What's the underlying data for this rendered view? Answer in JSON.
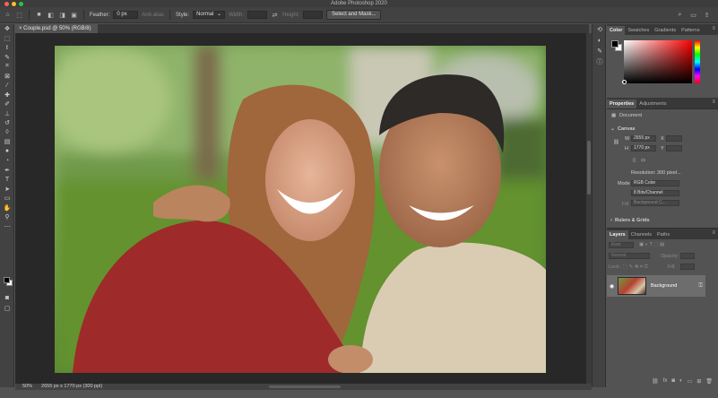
{
  "window": {
    "title": "Adobe Photoshop 2020"
  },
  "options_bar": {
    "feather_label": "Feather:",
    "feather_value": "0 px",
    "antialias_label": "Anti-alias",
    "style_label": "Style:",
    "style_value": "Normal",
    "width_label": "Width:",
    "height_label": "Height:",
    "select_mask_label": "Select and Mask..."
  },
  "document": {
    "tab_label": "Couple.psd @ 50% (RGB/8)",
    "zoom": "50%",
    "doc_info": "2655 px x 1770 px (300 ppi)"
  },
  "color_panel": {
    "tabs": [
      "Color",
      "Swatches",
      "Gradients",
      "Patterns"
    ],
    "colors": {
      "foreground": "#000000",
      "background": "#ffffff"
    }
  },
  "properties_panel": {
    "tabs": [
      "Properties",
      "Adjustments"
    ],
    "doc_label": "Document",
    "canvas_section": "Canvas",
    "w_label": "W",
    "w_value": "2655 px",
    "h_label": "H",
    "h_value": "1770 px",
    "x_label": "X",
    "y_label": "Y",
    "resolution": "Resolution: 300 pixel...",
    "mode_label": "Mode",
    "mode_value": "RGB Color",
    "bits_value": "8 Bits/Channel",
    "fill_label": "Fill",
    "fill_value": "Background C...",
    "rulers_section": "Rulers & Grids"
  },
  "layers_panel": {
    "tabs": [
      "Layers",
      "Channels",
      "Paths"
    ],
    "kind_label": "Kind",
    "blend_mode": "Normal",
    "opacity_label": "Opacity:",
    "lock_label": "Lock:",
    "fill_label": "Fill:",
    "layer_name": "Background"
  }
}
